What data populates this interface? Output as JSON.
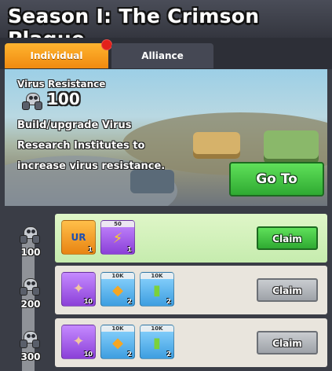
{
  "title": "Season I: The Crimson Plague",
  "tabs": [
    {
      "label": "Individual",
      "active": true,
      "notification": true
    },
    {
      "label": "Alliance",
      "active": false
    }
  ],
  "banner": {
    "stat_label": "Virus Resistance",
    "stat_value": "100",
    "description": "Build/upgrade Virus Research Institutes to increase virus resistance.",
    "go_to_label": "Go To"
  },
  "milestones": [
    {
      "level": "100",
      "claim_label": "Claim",
      "claimable": true,
      "rewards": [
        {
          "icon": "ur-badge-icon",
          "tag": "",
          "count": "1",
          "color": "orange",
          "symbol": "UR"
        },
        {
          "icon": "lightning-speedup-icon",
          "tag": "50",
          "count": "1",
          "color": "purple",
          "symbol": "⚡"
        }
      ]
    },
    {
      "level": "200",
      "claim_label": "Claim",
      "claimable": false,
      "rewards": [
        {
          "icon": "hero-shard-icon",
          "tag": "",
          "count": "10",
          "color": "purple",
          "symbol": "✦"
        },
        {
          "icon": "ore-resource-icon",
          "tag": "10K",
          "count": "2",
          "color": "blue",
          "symbol": "◆"
        },
        {
          "icon": "oil-vial-icon",
          "tag": "10K",
          "count": "2",
          "color": "blue",
          "symbol": "▮"
        }
      ]
    },
    {
      "level": "300",
      "claim_label": "Claim",
      "claimable": false,
      "rewards": [
        {
          "icon": "hero-shard-icon",
          "tag": "",
          "count": "10",
          "color": "purple",
          "symbol": "✦"
        },
        {
          "icon": "ore-resource-icon",
          "tag": "10K",
          "count": "2",
          "color": "blue",
          "symbol": "◆"
        },
        {
          "icon": "oil-vial-icon",
          "tag": "10K",
          "count": "2",
          "color": "blue",
          "symbol": "▮"
        }
      ]
    }
  ]
}
